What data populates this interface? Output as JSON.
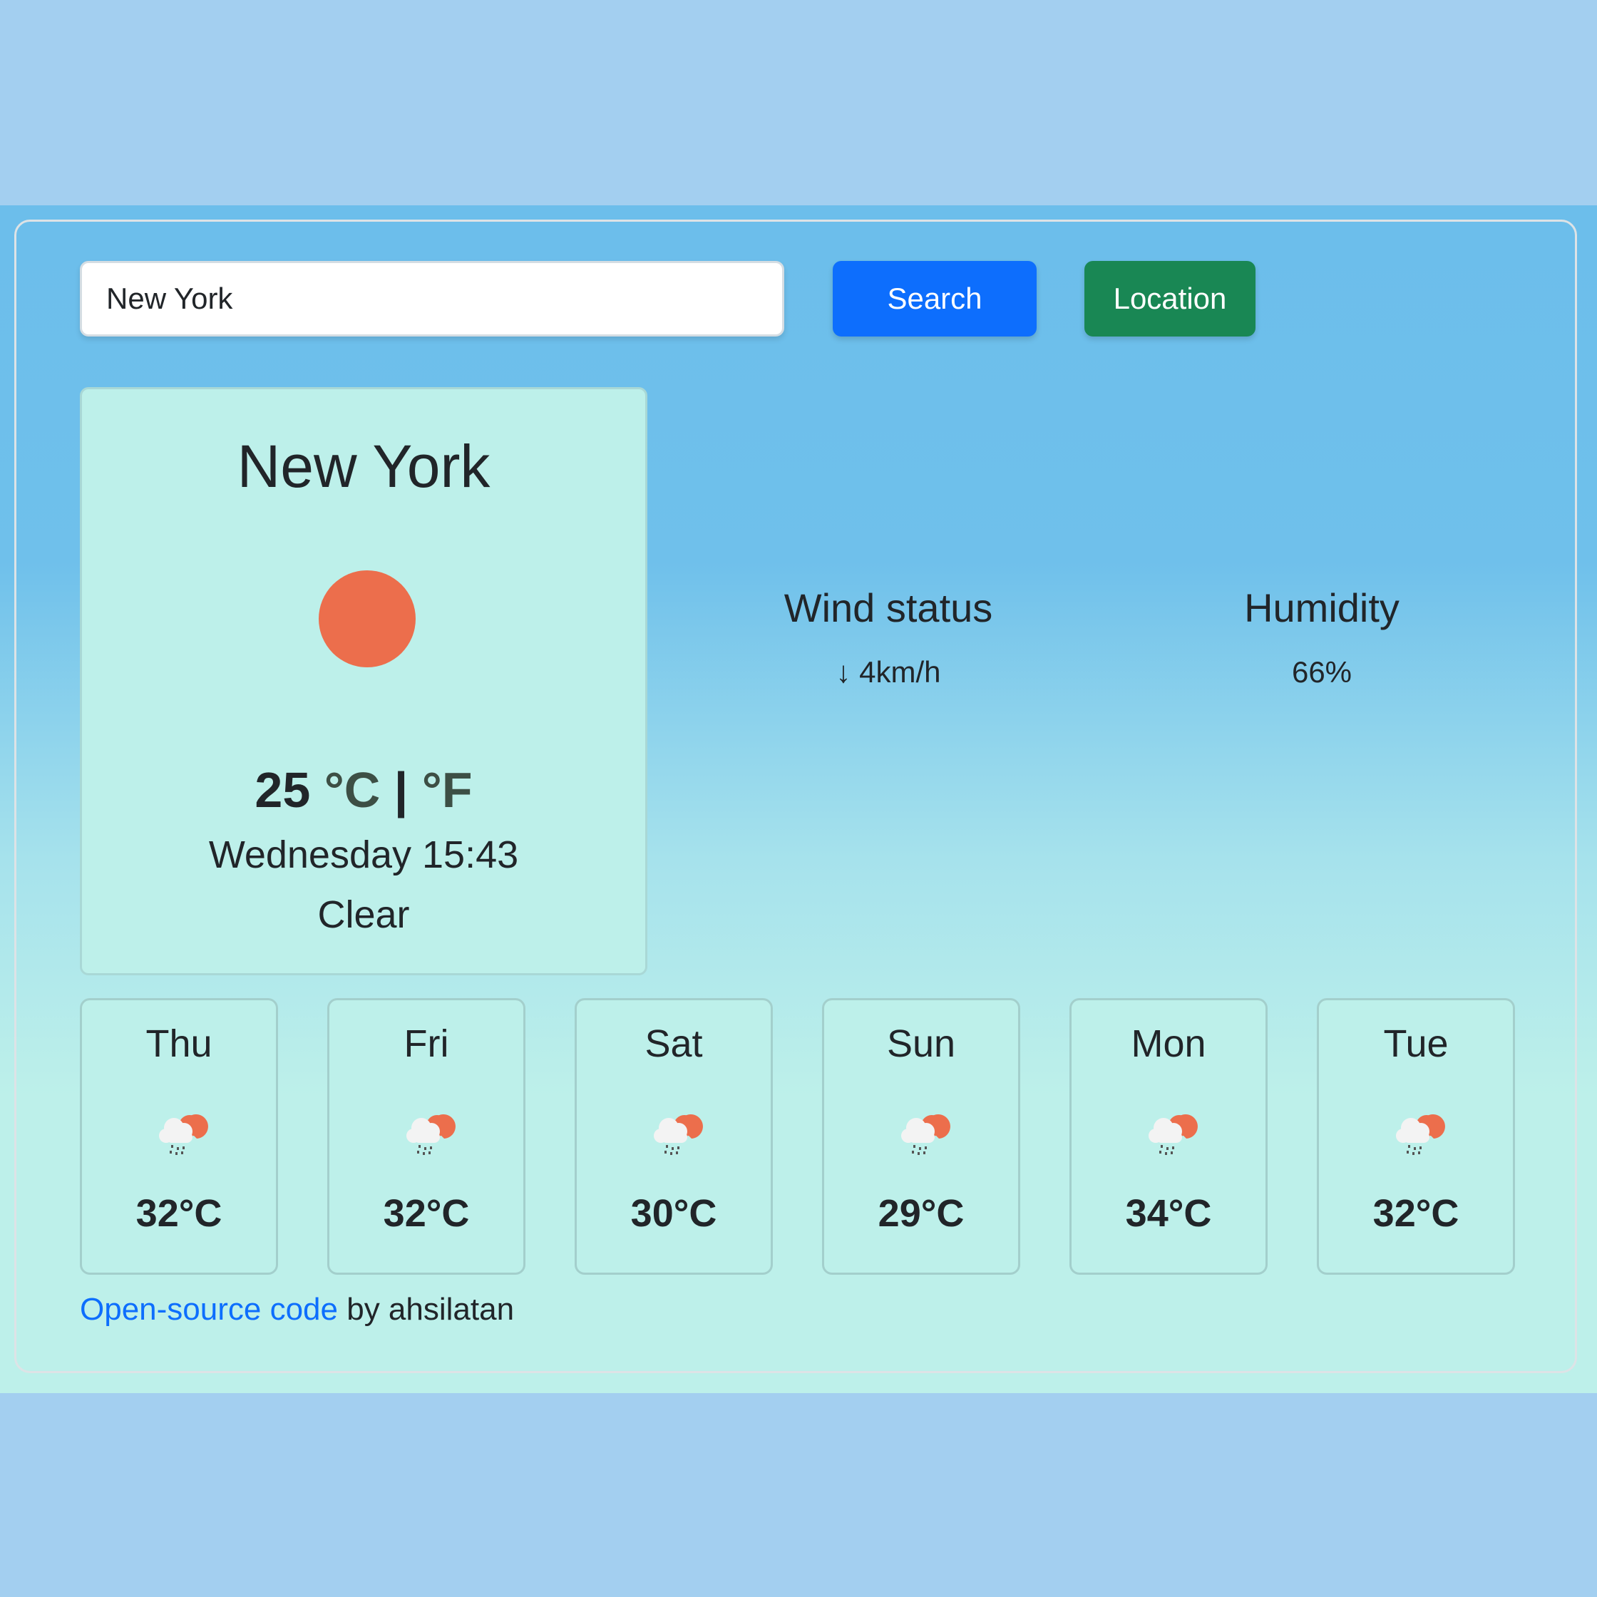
{
  "search": {
    "value": "New York",
    "search_label": "Search",
    "location_label": "Location"
  },
  "current": {
    "city": "New York",
    "icon": "clear-sun-icon",
    "temperature": "25",
    "unit_c": "°C",
    "separator": "|",
    "unit_f": "°F",
    "datetime": "Wednesday 15:43",
    "condition": "Clear"
  },
  "stats": {
    "wind": {
      "title": "Wind status",
      "value": "↓ 4km/h"
    },
    "humidity": {
      "title": "Humidity",
      "value": "66%"
    }
  },
  "forecast": [
    {
      "day": "Thu",
      "icon": "rain-cloud-sun-icon",
      "temp": "32°C"
    },
    {
      "day": "Fri",
      "icon": "rain-cloud-sun-icon",
      "temp": "32°C"
    },
    {
      "day": "Sat",
      "icon": "rain-cloud-sun-icon",
      "temp": "30°C"
    },
    {
      "day": "Sun",
      "icon": "rain-cloud-sun-icon",
      "temp": "29°C"
    },
    {
      "day": "Mon",
      "icon": "rain-cloud-sun-icon",
      "temp": "34°C"
    },
    {
      "day": "Tue",
      "icon": "rain-cloud-sun-icon",
      "temp": "32°C"
    }
  ],
  "footer": {
    "link_text": "Open-source code",
    "suffix": " by ahsilatan"
  },
  "colors": {
    "search_button": "#0d6efd",
    "location_button": "#198754",
    "sun": "#ec6e4c",
    "card_bg": "#bdf0ea",
    "page_bg": "#a3cff0"
  }
}
